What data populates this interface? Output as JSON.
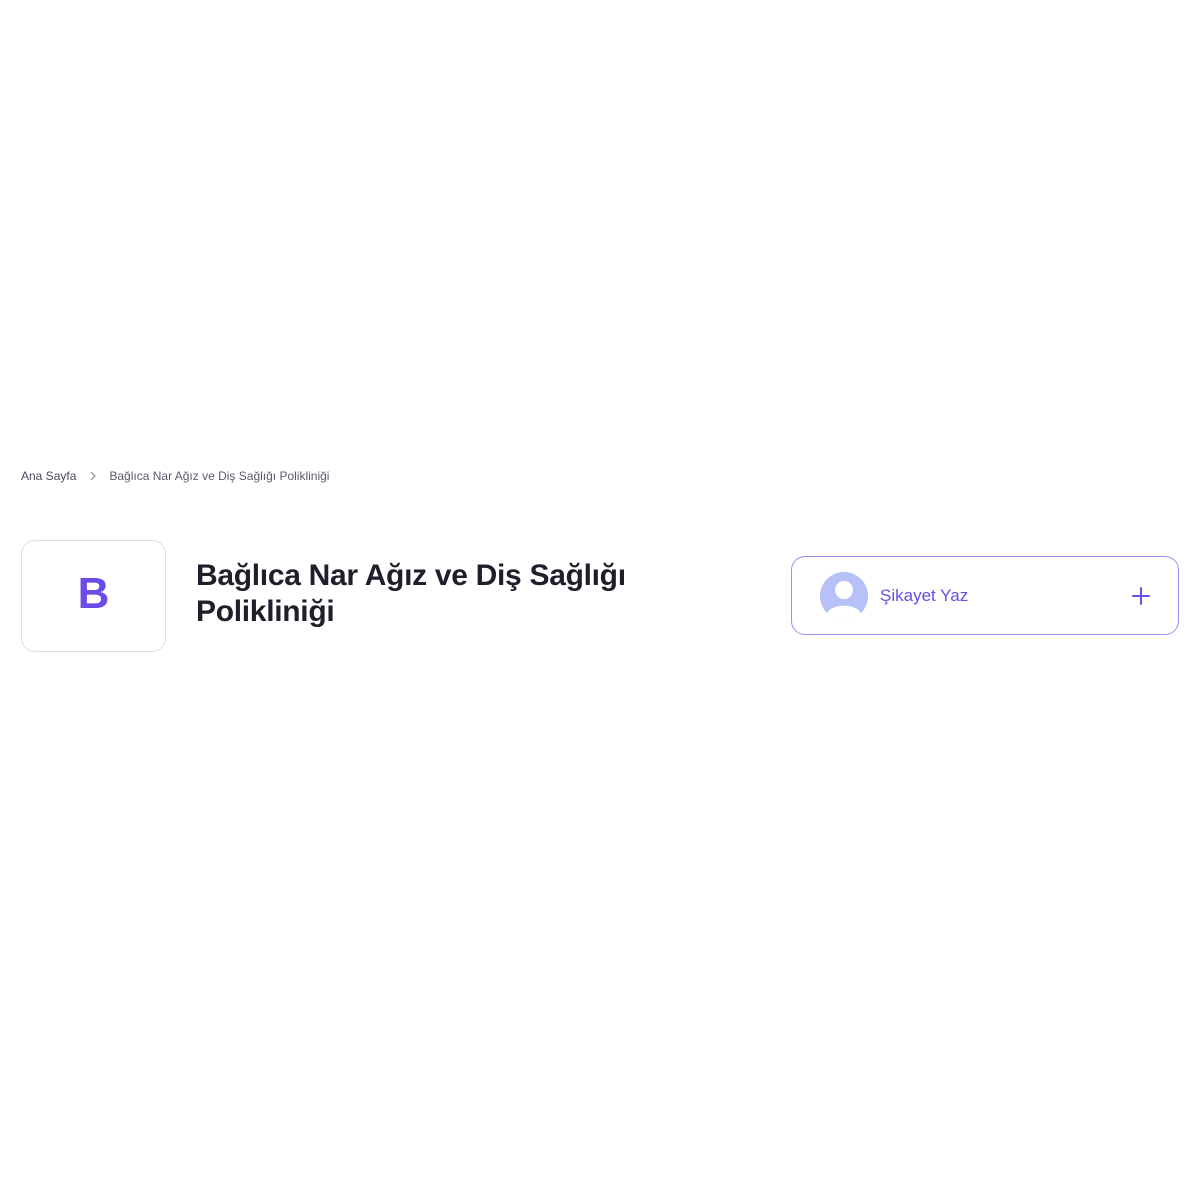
{
  "breadcrumb": {
    "home": "Ana Sayfa",
    "separator_icon": "chevron-right-icon",
    "current": "Bağlıca Nar Ağız ve Diş Sağlığı Polikliniği"
  },
  "company": {
    "logo_letter": "B",
    "title": "Bağlıca Nar Ağız ve Diş Sağlığı Polikliniği"
  },
  "complaint_button": {
    "label": "Şikayet Yaz",
    "avatar_icon": "user-avatar-icon",
    "action_icon": "plus-icon"
  },
  "colors": {
    "accent": "#6b4ce6",
    "border": "#dedee6",
    "button_border": "#9e8cf0",
    "avatar_bg": "#b6c2f7",
    "title": "#1f1f2b"
  }
}
